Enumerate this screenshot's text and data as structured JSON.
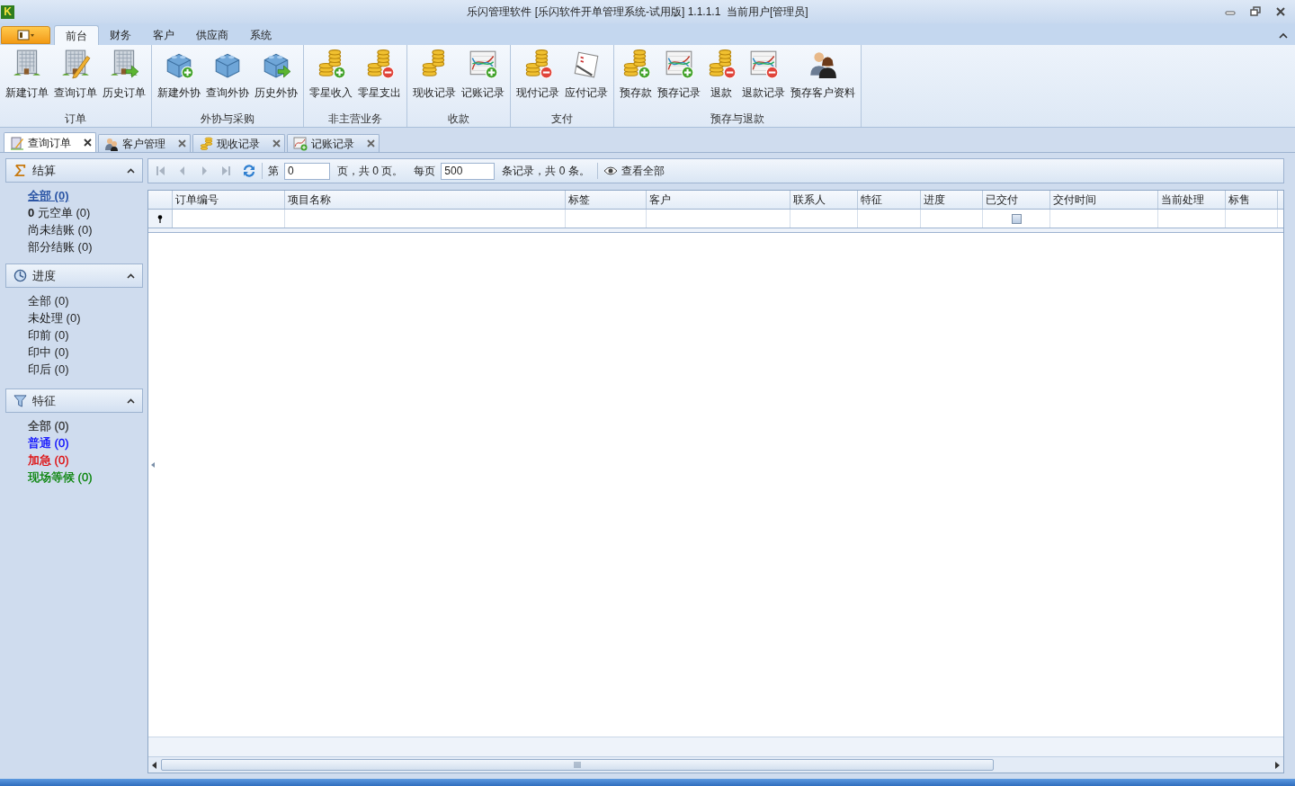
{
  "window": {
    "logo_letter": "K",
    "title": "乐闪管理软件 [乐闪软件开单管理系统-试用版] 1.1.1.1  当前用户[管理员]"
  },
  "ribbon": {
    "tabs": [
      {
        "label": "前台",
        "selected": true
      },
      {
        "label": "财务",
        "selected": false
      },
      {
        "label": "客户",
        "selected": false
      },
      {
        "label": "供应商",
        "selected": false
      },
      {
        "label": "系统",
        "selected": false
      }
    ],
    "groups": [
      {
        "label": "订单",
        "buttons": [
          {
            "label": "新建订单"
          },
          {
            "label": "查询订单"
          },
          {
            "label": "历史订单"
          }
        ]
      },
      {
        "label": "外协与采购",
        "buttons": [
          {
            "label": "新建外协"
          },
          {
            "label": "查询外协"
          },
          {
            "label": "历史外协"
          }
        ]
      },
      {
        "label": "非主营业务",
        "buttons": [
          {
            "label": "零星收入"
          },
          {
            "label": "零星支出"
          }
        ]
      },
      {
        "label": "收款",
        "buttons": [
          {
            "label": "现收记录"
          },
          {
            "label": "记账记录"
          }
        ]
      },
      {
        "label": "支付",
        "buttons": [
          {
            "label": "现付记录"
          },
          {
            "label": "应付记录"
          }
        ]
      },
      {
        "label": "预存与退款",
        "buttons": [
          {
            "label": "预存款"
          },
          {
            "label": "预存记录"
          },
          {
            "label": "退款"
          },
          {
            "label": "退款记录"
          },
          {
            "label": "预存客户资料"
          }
        ]
      }
    ]
  },
  "doc_tabs": [
    {
      "label": "查询订单",
      "selected": true
    },
    {
      "label": "客户管理",
      "selected": false
    },
    {
      "label": "现收记录",
      "selected": false
    },
    {
      "label": "记账记录",
      "selected": false
    }
  ],
  "sidebar": {
    "sections": [
      {
        "title": "结算",
        "expanded": true,
        "items": [
          {
            "label": "全部 (0)",
            "selected": true
          },
          {
            "label": "**0** 元空单 (0)",
            "selected": false
          },
          {
            "label": "尚未结账 (0)",
            "selected": false
          },
          {
            "label": "部分结账 (0)",
            "selected": false
          }
        ]
      },
      {
        "title": "进度",
        "expanded": true,
        "items": [
          {
            "label": "全部 (0)",
            "selected": false
          },
          {
            "label": "未处理 (0)",
            "selected": false
          },
          {
            "label": "印前 (0)",
            "selected": false
          },
          {
            "label": "印中 (0)",
            "selected": false
          },
          {
            "label": "印后 (0)",
            "selected": false
          }
        ]
      },
      {
        "title": "特征",
        "expanded": true,
        "items": [
          {
            "label": "全部 (0)",
            "selected": false,
            "color": "#333333"
          },
          {
            "label": "普通 (0)",
            "selected": false,
            "color": "#0000ff"
          },
          {
            "label": "加急 (0)",
            "selected": false,
            "color": "#e00000"
          },
          {
            "label": "现场等候 (0)",
            "selected": false,
            "color": "#008000"
          }
        ]
      }
    ]
  },
  "pager": {
    "page_prefix": "第",
    "page_value": "0",
    "page_suffix": "页，共 0 页。",
    "per_page_label": "每页",
    "per_page_value": "500",
    "records_text": "条记录，共 0 条。",
    "view_all_button": "查看全部"
  },
  "grid": {
    "columns": [
      {
        "label": "订单编号",
        "kind": "text"
      },
      {
        "label": "项目名称",
        "kind": "text"
      },
      {
        "label": "标签",
        "kind": "text"
      },
      {
        "label": "客户",
        "kind": "text"
      },
      {
        "label": "联系人",
        "kind": "text"
      },
      {
        "label": "特征",
        "kind": "text"
      },
      {
        "label": "进度",
        "kind": "text"
      },
      {
        "label": "已交付",
        "kind": "checkbox",
        "checked": false
      },
      {
        "label": "交付时间",
        "kind": "text"
      },
      {
        "label": "当前处理",
        "kind": "text"
      },
      {
        "label": "标售",
        "kind": "text"
      }
    ]
  }
}
